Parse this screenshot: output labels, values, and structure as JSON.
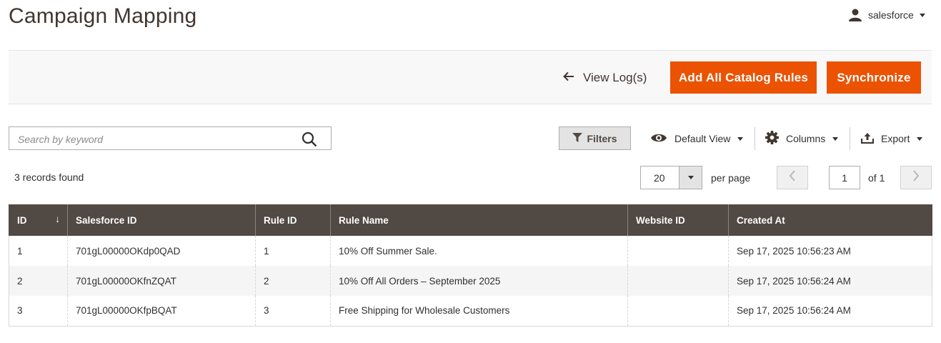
{
  "page": {
    "title": "Campaign Mapping"
  },
  "user": {
    "name": "salesforce"
  },
  "actions": {
    "back_label": "View Log(s)",
    "add_label": "Add All Catalog Rules",
    "sync_label": "Synchronize",
    "accent_color": "#eb5202"
  },
  "search": {
    "placeholder": "Search by keyword",
    "value": ""
  },
  "toolbar": {
    "filters_label": "Filters",
    "view_label": "Default View",
    "columns_label": "Columns",
    "export_label": "Export"
  },
  "records_label": "3 records found",
  "pagination": {
    "per_page_value": "20",
    "per_page_label": "per page",
    "current_page": "1",
    "of_label": "of 1"
  },
  "grid": {
    "columns": [
      "ID",
      "Salesforce ID",
      "Rule ID",
      "Rule Name",
      "Website ID",
      "Created At"
    ],
    "sort_icon": "↓",
    "rows": [
      [
        "1",
        "701gL00000OKdp0QAD",
        "1",
        "10% Off Summer Sale.",
        "",
        "Sep 17, 2025 10:56:23 AM"
      ],
      [
        "2",
        "701gL00000OKfnZQAT",
        "2",
        "10% Off All Orders – September 2025",
        "",
        "Sep 17, 2025 10:56:24 AM"
      ],
      [
        "3",
        "701gL00000OKfpBQAT",
        "3",
        "Free Shipping for Wholesale Customers",
        "",
        "Sep 17, 2025 10:56:24 AM"
      ]
    ]
  }
}
